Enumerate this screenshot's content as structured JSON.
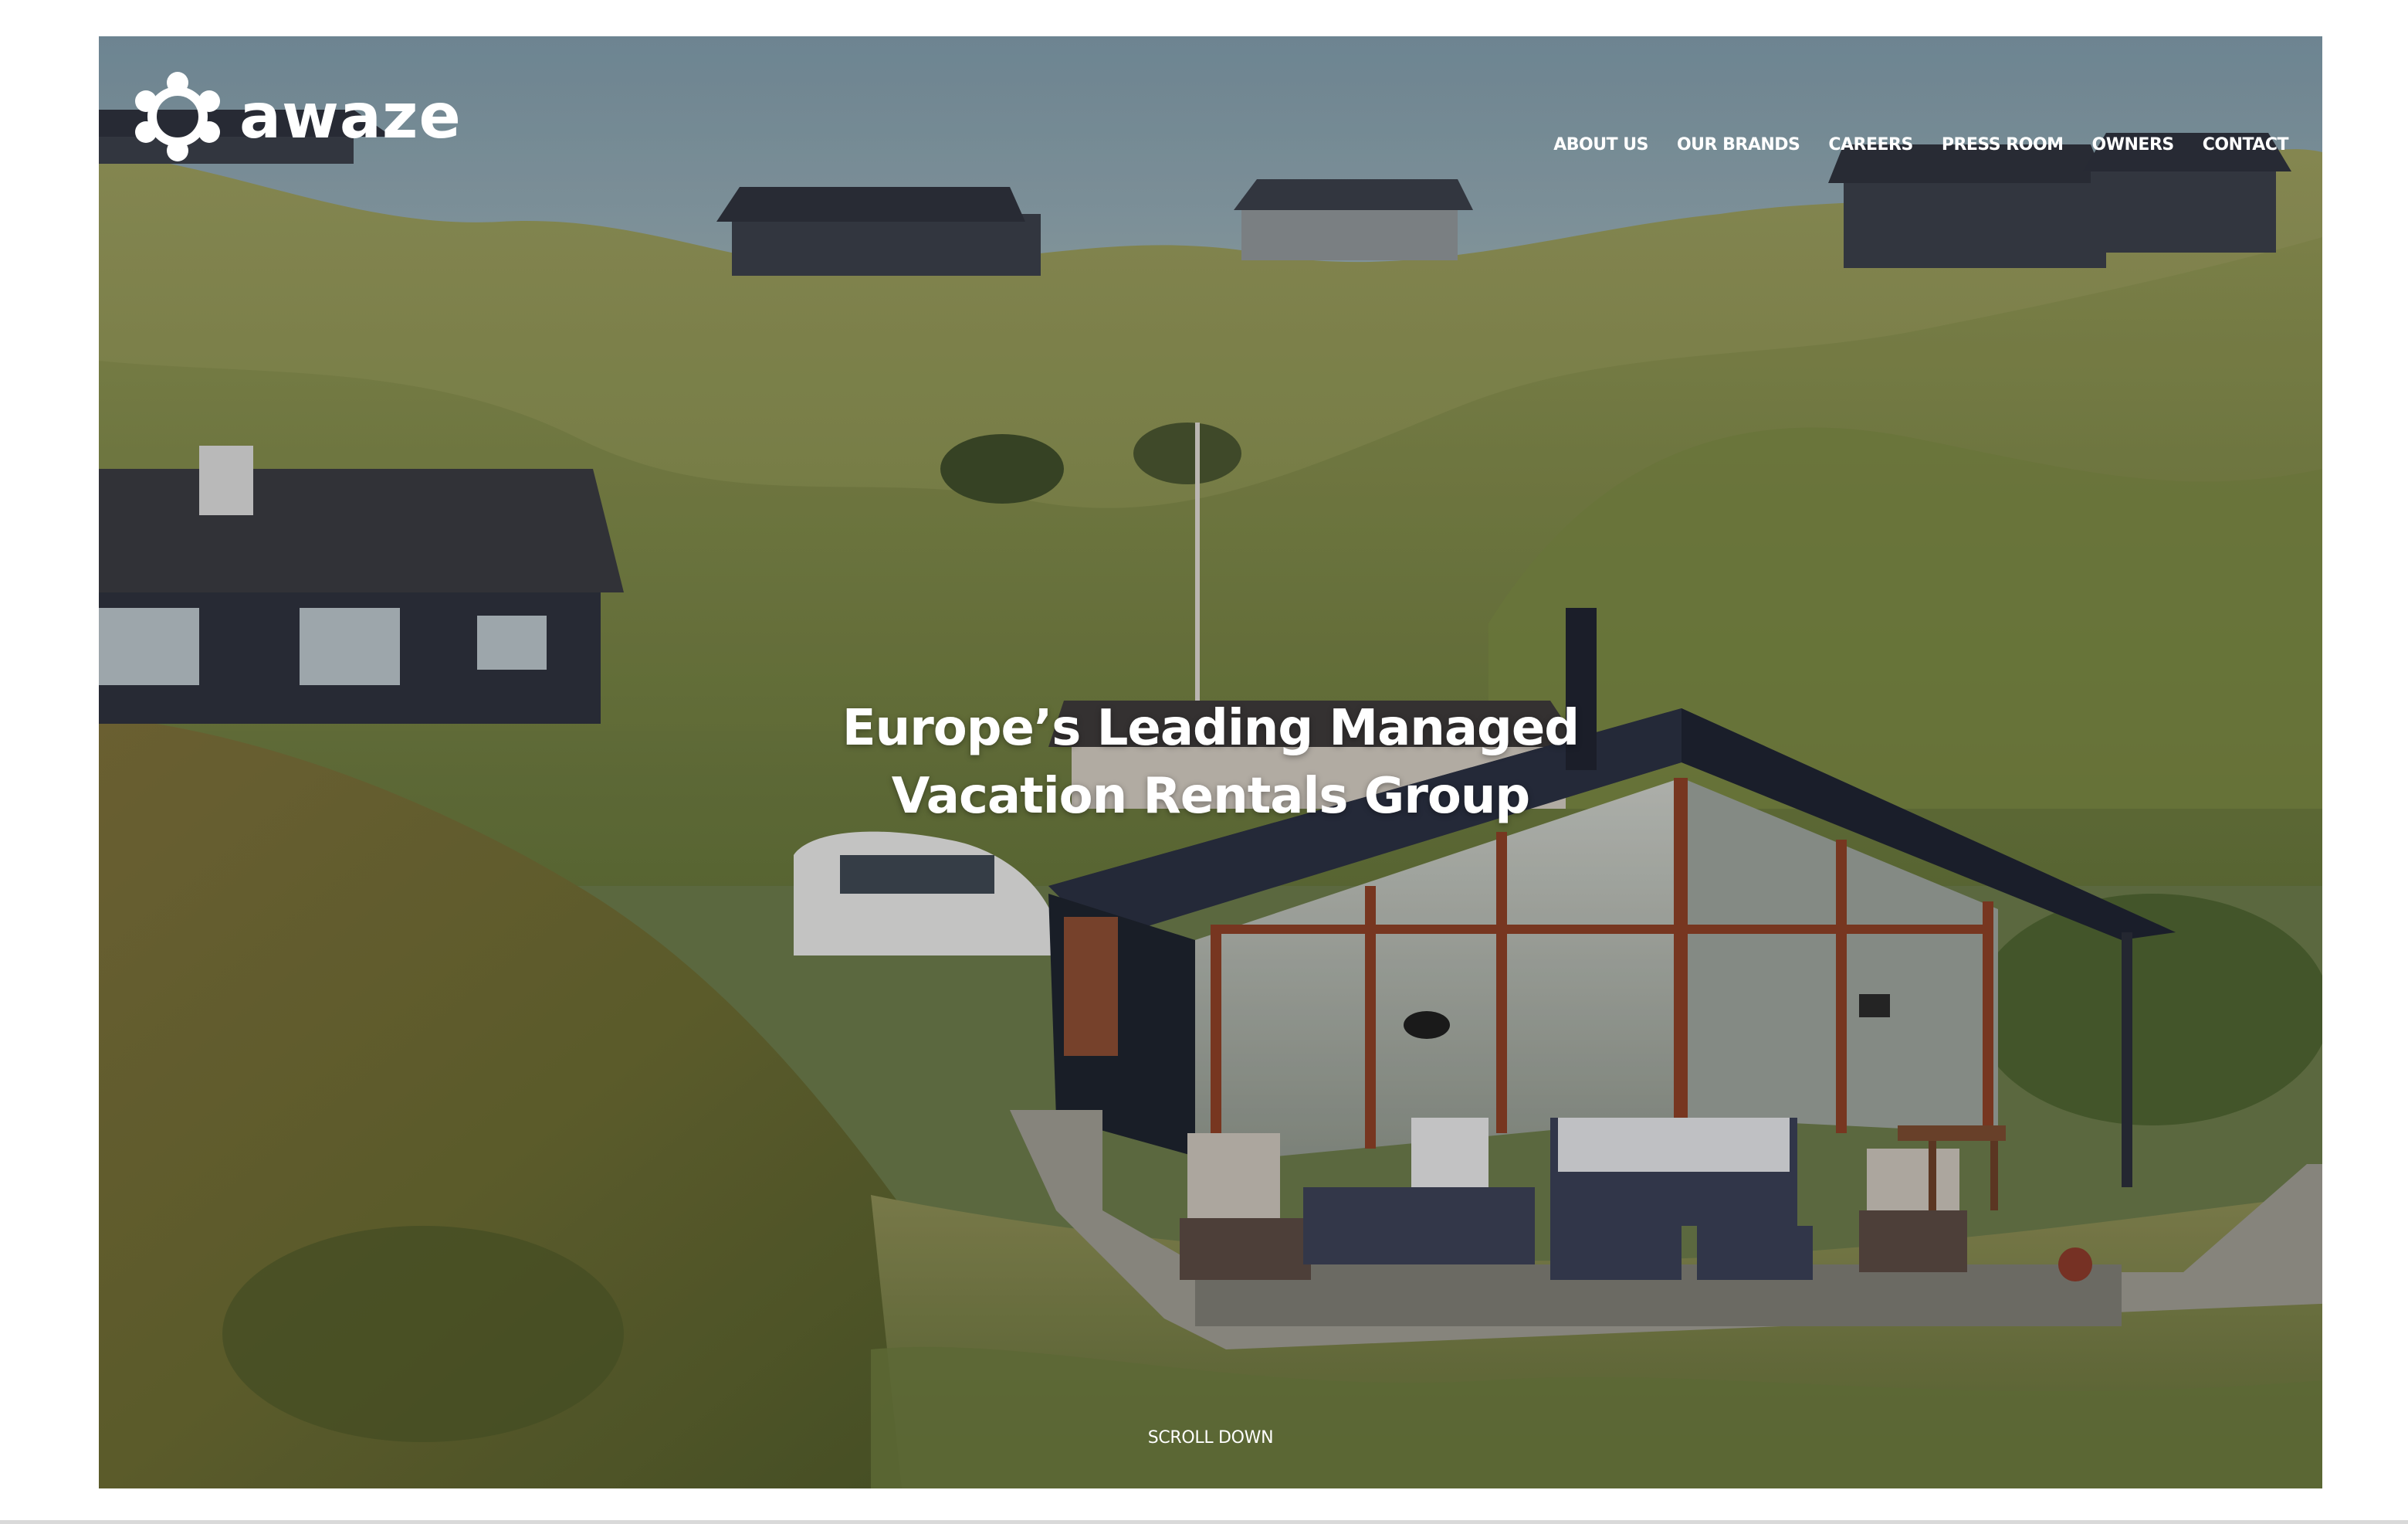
{
  "brand": {
    "name": "awaze",
    "logo_icon": "awaze-ring-logo-icon"
  },
  "nav": {
    "items": [
      {
        "label": "ABOUT US"
      },
      {
        "label": "OUR BRANDS"
      },
      {
        "label": "CAREERS"
      },
      {
        "label": "PRESS ROOM"
      },
      {
        "label": "OWNERS"
      },
      {
        "label": "CONTACT"
      }
    ]
  },
  "hero": {
    "line1": "Europe’s Leading Managed",
    "line2": "Vacation Rentals Group",
    "image": "dune-holiday-house-photo"
  },
  "scroll": {
    "label": "SCROLL DOWN"
  },
  "colors": {
    "text": "#ffffff",
    "page_background": "#ffffff"
  }
}
